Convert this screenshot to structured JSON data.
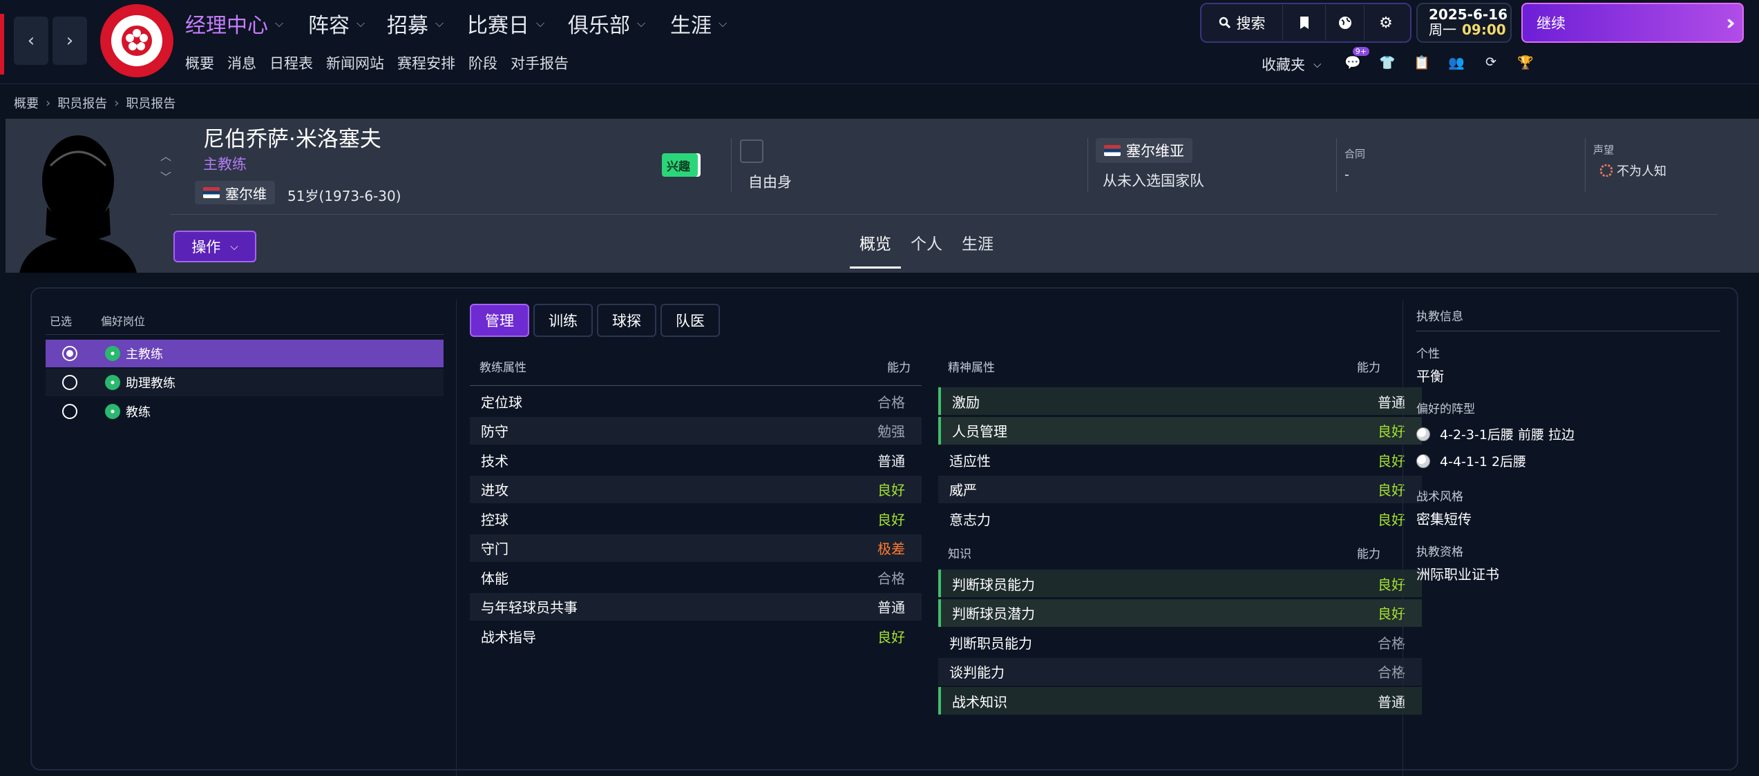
{
  "topbar": {
    "back_icon": "‹",
    "forward_icon": "›",
    "menus": [
      {
        "label": "经理中心",
        "active": true
      },
      {
        "label": "阵容",
        "active": false
      },
      {
        "label": "招募",
        "active": false
      },
      {
        "label": "比赛日",
        "active": false
      },
      {
        "label": "俱乐部",
        "active": false
      },
      {
        "label": "生涯",
        "active": false
      }
    ],
    "submenu": [
      "概要",
      "消息",
      "日程表",
      "新闻网站",
      "赛程安排",
      "阶段",
      "对手报告"
    ],
    "search_label": "搜索",
    "date": "2025-6-16",
    "weekday": "周一",
    "time": "09:00",
    "continue_label": "继续",
    "favorites_label": "收藏夹",
    "notification_badge": "9+",
    "accent_color": "#a44ee8",
    "brand_color": "#d6142a"
  },
  "breadcrumb": [
    "概要",
    "职员报告",
    "职员报告"
  ],
  "profile": {
    "name": "尼伯乔萨·米洛塞夫",
    "role": "主教练",
    "nationality": "塞尔维",
    "age": "51岁(1973-6-30)",
    "interest_label": "兴趣",
    "club_status": "自由身",
    "national_team": "塞尔维亚",
    "national_status": "从未入选国家队",
    "contract_label": "合同",
    "contract_value": "-",
    "reputation_label": "声望",
    "reputation_value": "不为人知",
    "actions_label": "操作",
    "tabs": [
      {
        "label": "概览",
        "active": true
      },
      {
        "label": "个人",
        "active": false
      },
      {
        "label": "生涯",
        "active": false
      }
    ]
  },
  "roles": {
    "header_selected": "已选",
    "header_role": "偏好岗位",
    "items": [
      {
        "name": "主教练",
        "selected": true
      },
      {
        "name": "助理教练",
        "selected": false
      },
      {
        "name": "教练",
        "selected": false
      }
    ]
  },
  "filter_tabs": [
    {
      "label": "管理",
      "active": true
    },
    {
      "label": "训练",
      "active": false
    },
    {
      "label": "球探",
      "active": false
    },
    {
      "label": "队医",
      "active": false
    }
  ],
  "coaching": {
    "header": "教练属性",
    "ability_header": "能力",
    "rows": [
      {
        "label": "定位球",
        "value": "合格",
        "cls": "v-ok"
      },
      {
        "label": "防守",
        "value": "勉强",
        "cls": "v-weak"
      },
      {
        "label": "技术",
        "value": "普通",
        "cls": "v-avg"
      },
      {
        "label": "进攻",
        "value": "良好",
        "cls": "v-good"
      },
      {
        "label": "控球",
        "value": "良好",
        "cls": "v-good"
      },
      {
        "label": "守门",
        "value": "极差",
        "cls": "v-bad"
      },
      {
        "label": "体能",
        "value": "合格",
        "cls": "v-ok"
      },
      {
        "label": "与年轻球员共事",
        "value": "普通",
        "cls": "v-avg"
      },
      {
        "label": "战术指导",
        "value": "良好",
        "cls": "v-good"
      }
    ]
  },
  "mental": {
    "header": "精神属性",
    "ability_header": "能力",
    "rows": [
      {
        "label": "激励",
        "value": "普通",
        "cls": "v-avg",
        "hl": true
      },
      {
        "label": "人员管理",
        "value": "良好",
        "cls": "v-good",
        "hl": true
      },
      {
        "label": "适应性",
        "value": "良好",
        "cls": "v-good",
        "hl": false
      },
      {
        "label": "威严",
        "value": "良好",
        "cls": "v-good",
        "hl": false
      },
      {
        "label": "意志力",
        "value": "良好",
        "cls": "v-good",
        "hl": false
      }
    ]
  },
  "knowledge": {
    "header": "知识",
    "ability_header": "能力",
    "rows": [
      {
        "label": "判断球员能力",
        "value": "良好",
        "cls": "v-good",
        "hl": true
      },
      {
        "label": "判断球员潜力",
        "value": "良好",
        "cls": "v-good",
        "hl": true
      },
      {
        "label": "判断职员能力",
        "value": "合格",
        "cls": "v-ok",
        "hl": false
      },
      {
        "label": "谈判能力",
        "value": "合格",
        "cls": "v-ok",
        "hl": false
      },
      {
        "label": "战术知识",
        "value": "普通",
        "cls": "v-avg",
        "hl": true
      }
    ]
  },
  "coaching_info": {
    "title": "执教信息",
    "personality_label": "个性",
    "personality_value": "平衡",
    "formations_label": "偏好的阵型",
    "formations": [
      "4-2-3-1后腰 前腰 拉边",
      "4-4-1-1 2后腰"
    ],
    "style_label": "战术风格",
    "style_value": "密集短传",
    "license_label": "执教资格",
    "license_value": "洲际职业证书"
  }
}
